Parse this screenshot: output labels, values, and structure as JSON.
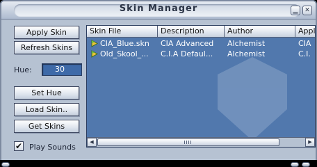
{
  "window": {
    "title": "Skin Manager",
    "minimize_icon": "minimize-icon",
    "close_icon": "close-icon"
  },
  "controls": {
    "apply_label": "Apply Skin",
    "refresh_label": "Refresh Skins",
    "hue_label": "Hue:",
    "hue_value": "30",
    "set_hue_label": "Set Hue",
    "load_skin_label": "Load Skin..",
    "get_skins_label": "Get Skins",
    "play_sounds_label": "Play Sounds",
    "play_sounds_checked": true
  },
  "list": {
    "columns": [
      "Skin File",
      "Description",
      "Author",
      "Appl"
    ],
    "rows": [
      [
        "CIA_Blue.skn",
        "CIA Advanced",
        "Alchemist",
        "CIA"
      ],
      [
        "Old_Skool_...",
        "C.I.A Defaul...",
        "Alchemist",
        "C.I."
      ]
    ]
  },
  "colors": {
    "list_background": "#5178ad",
    "window_background": "#b6c2d2",
    "list_text": "#ffffff"
  }
}
